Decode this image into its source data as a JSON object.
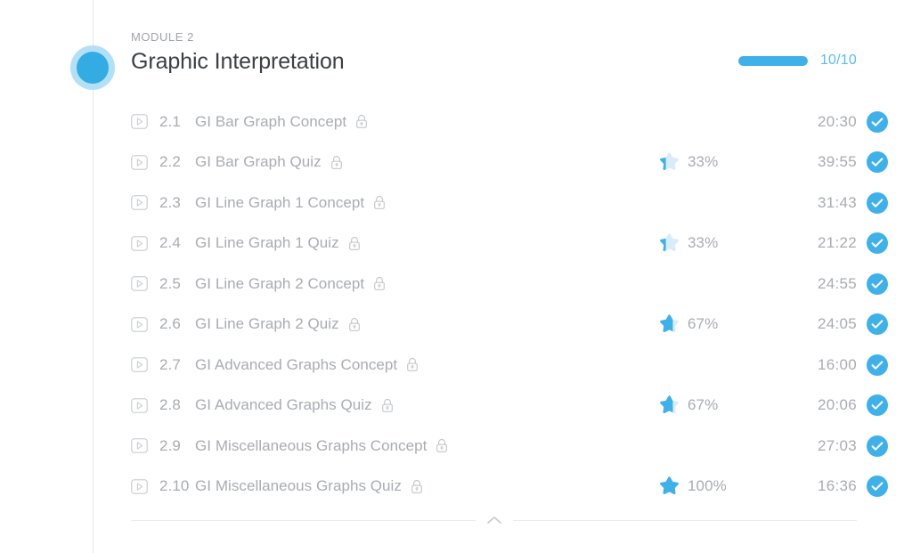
{
  "module": {
    "kicker": "MODULE 2",
    "title": "Graphic Interpretation",
    "status_dot_color": "#33ace3",
    "status_dot_halo_color": "#b3e0f7"
  },
  "progress": {
    "count_label": "10/10",
    "percent": 100,
    "fill_color": "#3fb1e8",
    "track_color": "#e6e8ea",
    "label_color": "#5bbcea"
  },
  "colors": {
    "accent": "#3fb1e8",
    "star_filled": "#3fb1e8",
    "star_empty": "#d8ecf9",
    "muted_text": "#a9acb1",
    "title_text": "#3c4043",
    "rail": "#e8e8ea"
  },
  "icons": {
    "play": "play-icon",
    "lock": "lock-icon",
    "star": "star-icon",
    "check": "check-circle-icon",
    "collapse": "chevron-up-icon"
  },
  "lessons": [
    {
      "index": "2.1",
      "title": "GI Bar Graph Concept",
      "locked": true,
      "score_pct": null,
      "score_label": "",
      "duration": "20:30",
      "completed": true
    },
    {
      "index": "2.2",
      "title": "GI Bar Graph Quiz",
      "locked": true,
      "score_pct": 33,
      "score_label": "33%",
      "duration": "39:55",
      "completed": true
    },
    {
      "index": "2.3",
      "title": "GI Line Graph 1 Concept",
      "locked": true,
      "score_pct": null,
      "score_label": "",
      "duration": "31:43",
      "completed": true
    },
    {
      "index": "2.4",
      "title": "GI Line Graph 1 Quiz",
      "locked": true,
      "score_pct": 33,
      "score_label": "33%",
      "duration": "21:22",
      "completed": true
    },
    {
      "index": "2.5",
      "title": "GI Line Graph 2 Concept",
      "locked": true,
      "score_pct": null,
      "score_label": "",
      "duration": "24:55",
      "completed": true
    },
    {
      "index": "2.6",
      "title": "GI Line Graph 2 Quiz",
      "locked": true,
      "score_pct": 67,
      "score_label": "67%",
      "duration": "24:05",
      "completed": true
    },
    {
      "index": "2.7",
      "title": "GI Advanced Graphs Concept",
      "locked": true,
      "score_pct": null,
      "score_label": "",
      "duration": "16:00",
      "completed": true
    },
    {
      "index": "2.8",
      "title": "GI Advanced Graphs Quiz",
      "locked": true,
      "score_pct": 67,
      "score_label": "67%",
      "duration": "20:06",
      "completed": true
    },
    {
      "index": "2.9",
      "title": "GI Miscellaneous Graphs Concept",
      "locked": true,
      "score_pct": null,
      "score_label": "",
      "duration": "27:03",
      "completed": true
    },
    {
      "index": "2.10",
      "title": "GI Miscellaneous Graphs Quiz",
      "locked": true,
      "score_pct": 100,
      "score_label": "100%",
      "duration": "16:36",
      "completed": true
    }
  ]
}
